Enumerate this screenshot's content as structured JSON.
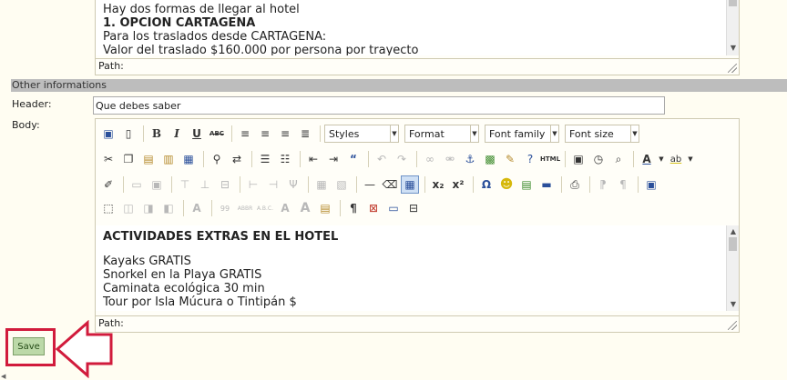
{
  "upper_editor": {
    "lines": [
      "Hay dos formas de llegar al hotel",
      "1. OPCION CARTAGENA",
      "Para los traslados desde CARTAGENA:",
      "Valor del traslado $160.000 por persona por trayecto"
    ],
    "path_label": "Path:"
  },
  "section": {
    "title": "Other informations"
  },
  "header_field": {
    "label": "Header:",
    "value": "Que debes saber"
  },
  "body_field": {
    "label": "Body:"
  },
  "toolbar": {
    "styles": "Styles",
    "format": "Format",
    "font_family": "Font family",
    "font_size": "Font size",
    "bold": "B",
    "italic": "I",
    "underline": "U",
    "strike": "ABC",
    "html": "HTML",
    "subscript": "x₂",
    "superscript": "x²",
    "omega": "Ω",
    "pilcrow": "¶"
  },
  "body_editor": {
    "heading": "ACTIVIDADES EXTRAS EN EL HOTEL",
    "lines": [
      "Kayaks GRATIS",
      "Snorkel en la Playa GRATIS",
      "Caminata ecológica 30 min",
      "Tour por Isla Múcura o Tintipán $"
    ],
    "path_label": "Path:"
  },
  "save_button": {
    "label": "Save"
  },
  "colors": {
    "highlight": "#d11b3c",
    "save_bg": "#bcd9a8",
    "section_bar": "#bdbdbd"
  }
}
